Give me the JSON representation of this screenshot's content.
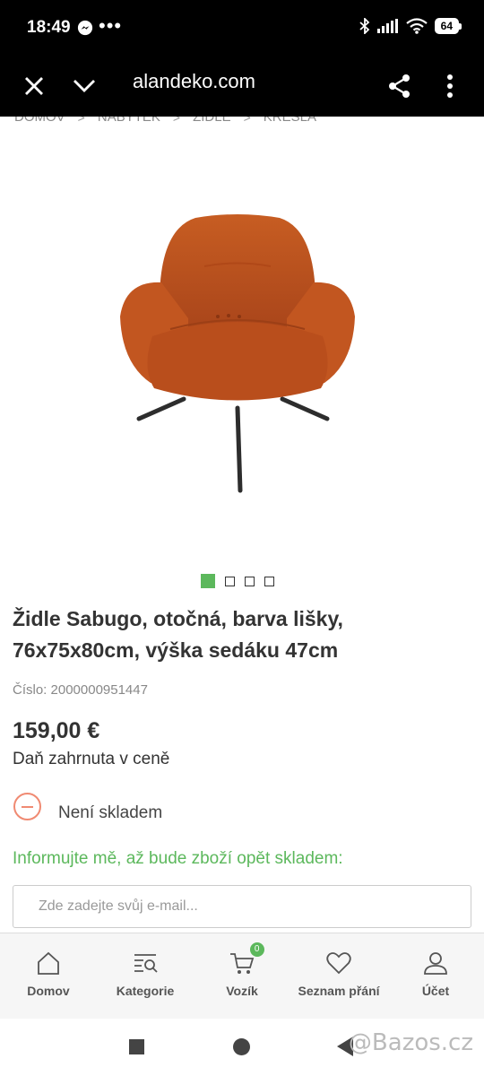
{
  "status_bar": {
    "time": "18:49",
    "battery": "64"
  },
  "browser": {
    "url": "alandeko.com"
  },
  "breadcrumb": [
    "DOMOV",
    "NÁBYTEK",
    "ŽIDLE",
    "KŘESLA"
  ],
  "product": {
    "title": "Židle Sabugo, otočná, barva lišky, 76x75x80cm, výška sedáku 47cm",
    "sku": "Číslo: 2000000951447",
    "price": "159,00 €",
    "tax_note": "Daň zahrnuta v ceně",
    "stock_status": "Není skladem",
    "image_count": 4,
    "active_image": 1
  },
  "notify": {
    "label": "Informujte mě, až bude zboží opět skladem:",
    "email_placeholder": "Zde zadejte svůj e-mail..."
  },
  "bottom_nav": {
    "home": "Domov",
    "categories": "Kategorie",
    "cart": "Vozík",
    "cart_count": "0",
    "wishlist": "Seznam přání",
    "account": "Účet"
  },
  "watermark": "@Bazos.cz",
  "colors": {
    "accent_green": "#5cb85c",
    "out_of_stock": "#f08a72",
    "chair": "#c65a1e"
  }
}
